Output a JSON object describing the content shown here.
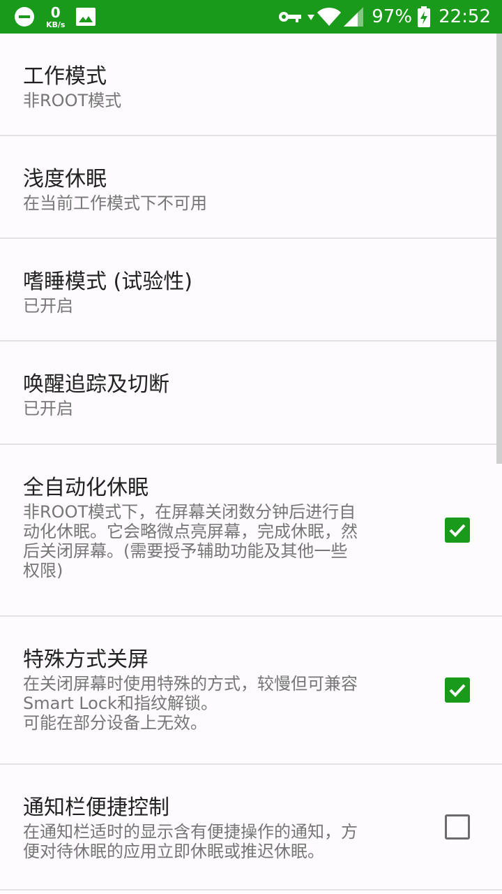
{
  "status_bar": {
    "net_speed_value": "0",
    "net_speed_unit": "KB/s",
    "battery_percent": "97%",
    "time": "22:52",
    "icons": [
      "do-not-disturb-icon",
      "image-icon",
      "vpn-key-icon",
      "wifi-icon",
      "signal-icon",
      "battery-charging-icon"
    ]
  },
  "settings": {
    "work_mode": {
      "title": "工作模式",
      "summary": "非ROOT模式"
    },
    "light_doze": {
      "title": "浅度休眠",
      "summary": "在当前工作模式下不可用"
    },
    "doze_mode": {
      "title": "嗜睡模式 (试验性)",
      "summary": "已开启"
    },
    "wakeup_tracking": {
      "title": "唤醒追踪及切断",
      "summary": "已开启"
    },
    "auto_hibernate": {
      "title": "全自动化休眠",
      "summary": "非ROOT模式下，在屏幕关闭数分钟后进行自\n动化休眠。它会略微点亮屏幕，完成休眠，然\n后关闭屏幕。(需要授予辅助功能及其他一些\n权限)",
      "checked": true
    },
    "special_screen_off": {
      "title": "特殊方式关屏",
      "summary": "在关闭屏幕时使用特殊的方式，较慢但可兼容\nSmart Lock和指纹解锁。\n可能在部分设备上无效。",
      "checked": true
    },
    "notification_control": {
      "title": "通知栏便捷控制",
      "summary": "在通知栏适时的显示含有便捷操作的通知，方\n便对待休眠的应用立即休眠或推迟休眠。",
      "checked": false
    }
  },
  "colors": {
    "accent": "#1a9a1a",
    "status_bar": "#1a9a1a",
    "background": "#fdfbfd"
  }
}
